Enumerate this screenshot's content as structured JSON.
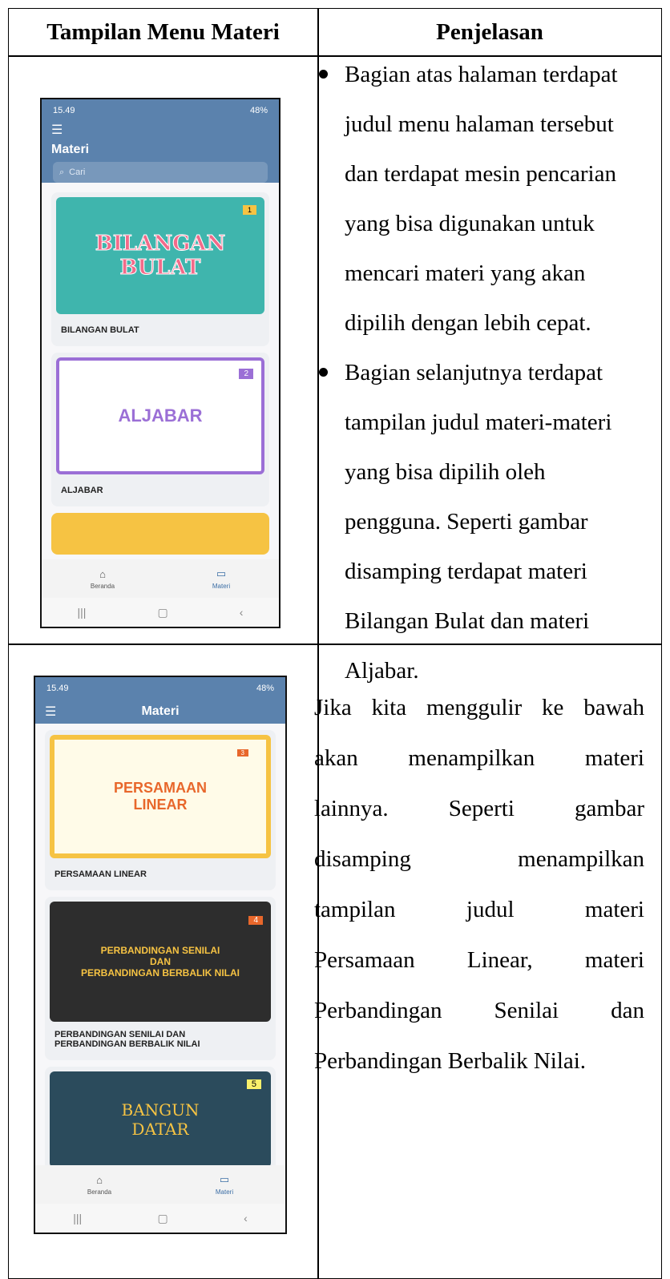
{
  "table": {
    "header_left": "Tampilan Menu Materi",
    "header_right": "Penjelasan"
  },
  "row1": {
    "bullets": [
      [
        "Bagian atas halaman terdapat",
        "judul menu halaman tersebut",
        "dan terdapat mesin pencarian",
        "yang bisa digunakan untuk",
        "mencari materi yang akan",
        "dipilih dengan lebih cepat."
      ],
      [
        "Bagian selanjutnya terdapat",
        "tampilan judul materi-materi",
        "yang bisa dipilih oleh",
        "pengguna. Seperti gambar",
        "disamping terdapat materi",
        "Bilangan Bulat dan materi",
        "Aljabar."
      ]
    ]
  },
  "row2": {
    "para_lines": [
      [
        "Jika",
        "kita",
        "menggulir",
        "ke",
        "bawah"
      ],
      [
        "akan",
        "menampilkan",
        "materi"
      ],
      [
        "lainnya.",
        "Seperti",
        "gambar"
      ],
      [
        "disamping",
        "menampilkan"
      ],
      [
        "tampilan",
        "judul",
        "materi"
      ],
      [
        "Persamaan",
        "Linear,",
        "materi"
      ],
      [
        "Perbandingan",
        "Senilai",
        "dan"
      ],
      [
        "Perbandingan Berbalik Nilai."
      ]
    ]
  },
  "phone1": {
    "time": "15.49",
    "status_right": "48%",
    "title": "Materi",
    "search_placeholder": "Cari",
    "cards": [
      {
        "banner_title": "BILANGAN BULAT",
        "label": "BILANGAN BULAT",
        "badge": "1"
      },
      {
        "banner_title": "ALJABAR",
        "label": "ALJABAR",
        "badge": "2"
      }
    ],
    "nav": {
      "home": "Beranda",
      "materi": "Materi"
    }
  },
  "phone2": {
    "time": "15.49",
    "status_right": "48%",
    "title": "Materi",
    "cards": [
      {
        "banner_title_1": "PERSAMAAN",
        "banner_title_2": "LINEAR",
        "label": "PERSAMAAN LINEAR",
        "badge": "3"
      },
      {
        "banner_title_1": "PERBANDINGAN SENILAI",
        "banner_title_2": "DAN",
        "banner_title_3": "PERBANDINGAN BERBALIK NILAI",
        "label_1": "PERBANDINGAN SENILAI DAN",
        "label_2": "PERBANDINGAN BERBALIK NILAI",
        "badge": "4"
      },
      {
        "banner_title_1": "BANGUN",
        "banner_title_2": "DATAR",
        "badge": "5"
      }
    ],
    "nav": {
      "home": "Beranda",
      "materi": "Materi"
    }
  },
  "colors": {
    "appbar": "#5b82ad",
    "teal": "#3fb5ad",
    "purple": "#9b6fd6",
    "yellow": "#f6c343",
    "dark": "#2d2d2d",
    "navy": "#2b4b5c"
  }
}
